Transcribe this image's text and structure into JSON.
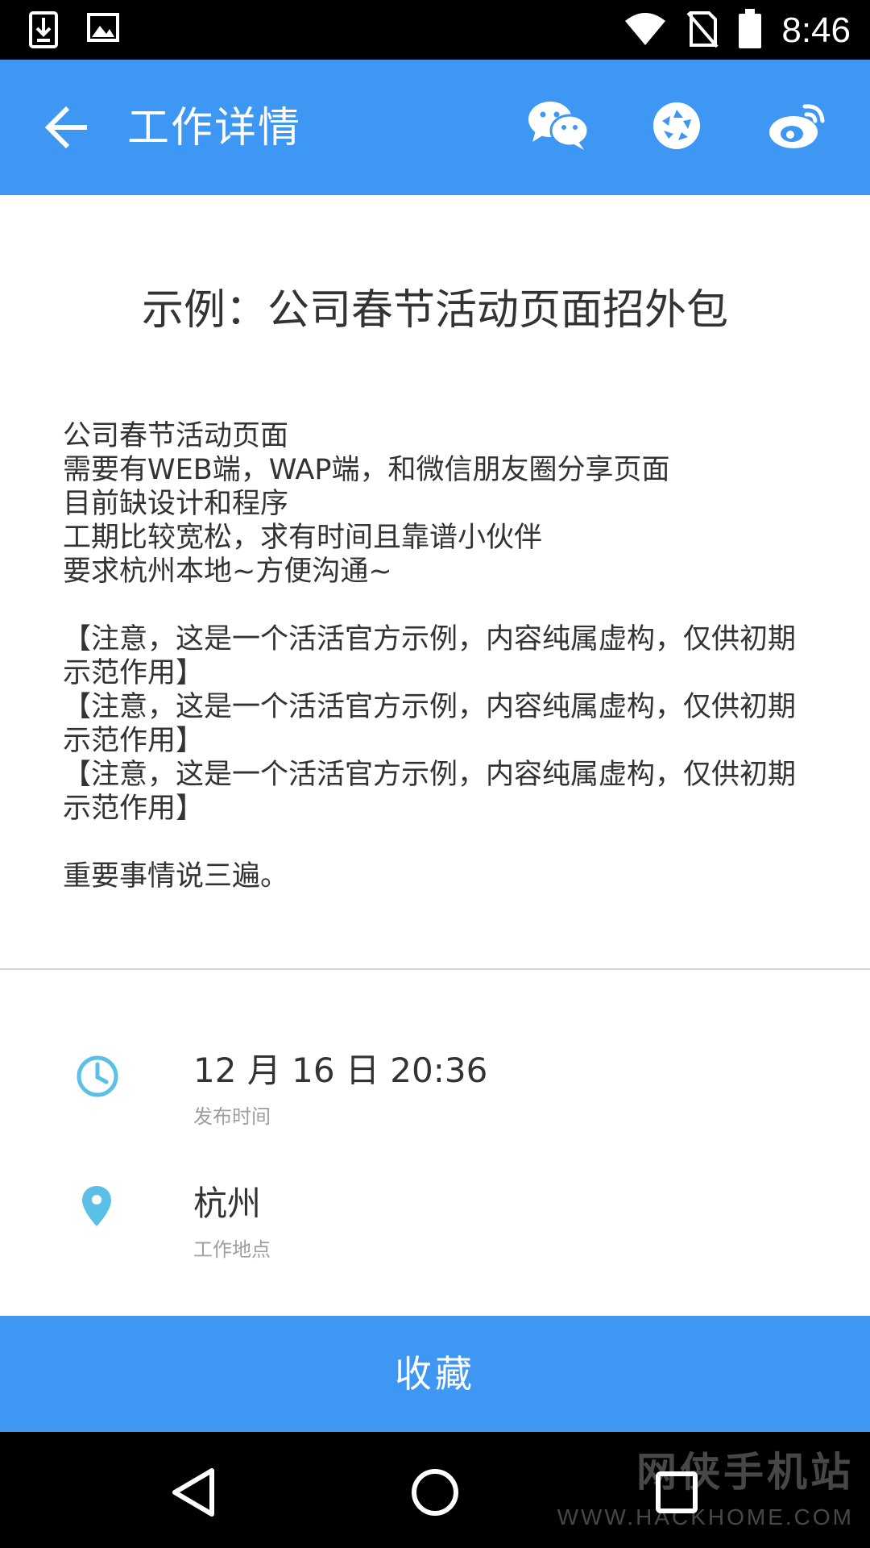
{
  "status_bar": {
    "time": "8:46",
    "left_icons": [
      "download-icon",
      "image-icon"
    ],
    "right_icons": [
      "wifi-icon",
      "no-sim-icon",
      "battery-icon"
    ]
  },
  "app_bar": {
    "title": "工作详情",
    "back_icon": "arrow-left-icon",
    "share_icons": [
      "wechat-icon",
      "moments-icon",
      "weibo-icon"
    ],
    "background": "#3d97f3"
  },
  "job": {
    "title": "示例：公司春节活动页面招外包",
    "description": "公司春节活动页面\n需要有WEB端，WAP端，和微信朋友圈分享页面\n目前缺设计和程序\n工期比较宽松，求有时间且靠谱小伙伴\n要求杭州本地~方便沟通~\n\n【注意，这是一个活活官方示例，内容纯属虚构，仅供初期示范作用】\n【注意，这是一个活活官方示例，内容纯属虚构，仅供初期示范作用】\n【注意，这是一个活活官方示例，内容纯属虚构，仅供初期示范作用】\n\n重要事情说三遍。"
  },
  "info": {
    "time_value": "12 月 16 日 20:36",
    "time_label": "发布时间",
    "location_value": "杭州",
    "location_label": "工作地点",
    "icon_color": "#5bc0e8"
  },
  "actions": {
    "favorite_label": "收藏"
  },
  "nav_bar": {
    "icons": [
      "back-triangle-icon",
      "home-circle-icon",
      "recents-square-icon"
    ]
  },
  "watermark": {
    "brand": "网侠手机站",
    "url": "WWW.HACKHOME.COM"
  }
}
